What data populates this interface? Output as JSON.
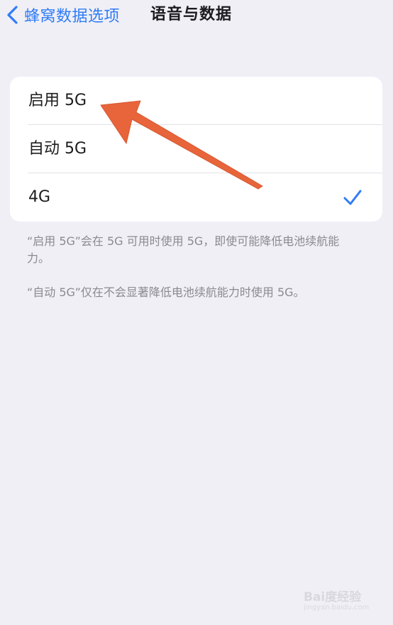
{
  "nav": {
    "back_label": "蜂窝数据选项",
    "title": "语音与数据"
  },
  "options": [
    {
      "label": "启用 5G",
      "selected": false
    },
    {
      "label": "自动 5G",
      "selected": false
    },
    {
      "label": "4G",
      "selected": true
    }
  ],
  "footnotes": [
    "“启用 5G”会在 5G 可用时使用 5G，即使可能降低电池续航能力。",
    "“自动 5G”仅在不会显著降低电池续航能力时使用 5G。"
  ],
  "icons": {
    "back": "chevron-left-icon",
    "check": "checkmark-icon",
    "annotation": "arrow-icon"
  },
  "colors": {
    "accent": "#2f7cf6",
    "background": "#f0eff6",
    "arrow": "#e8643a"
  },
  "watermark": {
    "brand": "Bai度经验",
    "sub": "jingyan.baidu.com"
  }
}
